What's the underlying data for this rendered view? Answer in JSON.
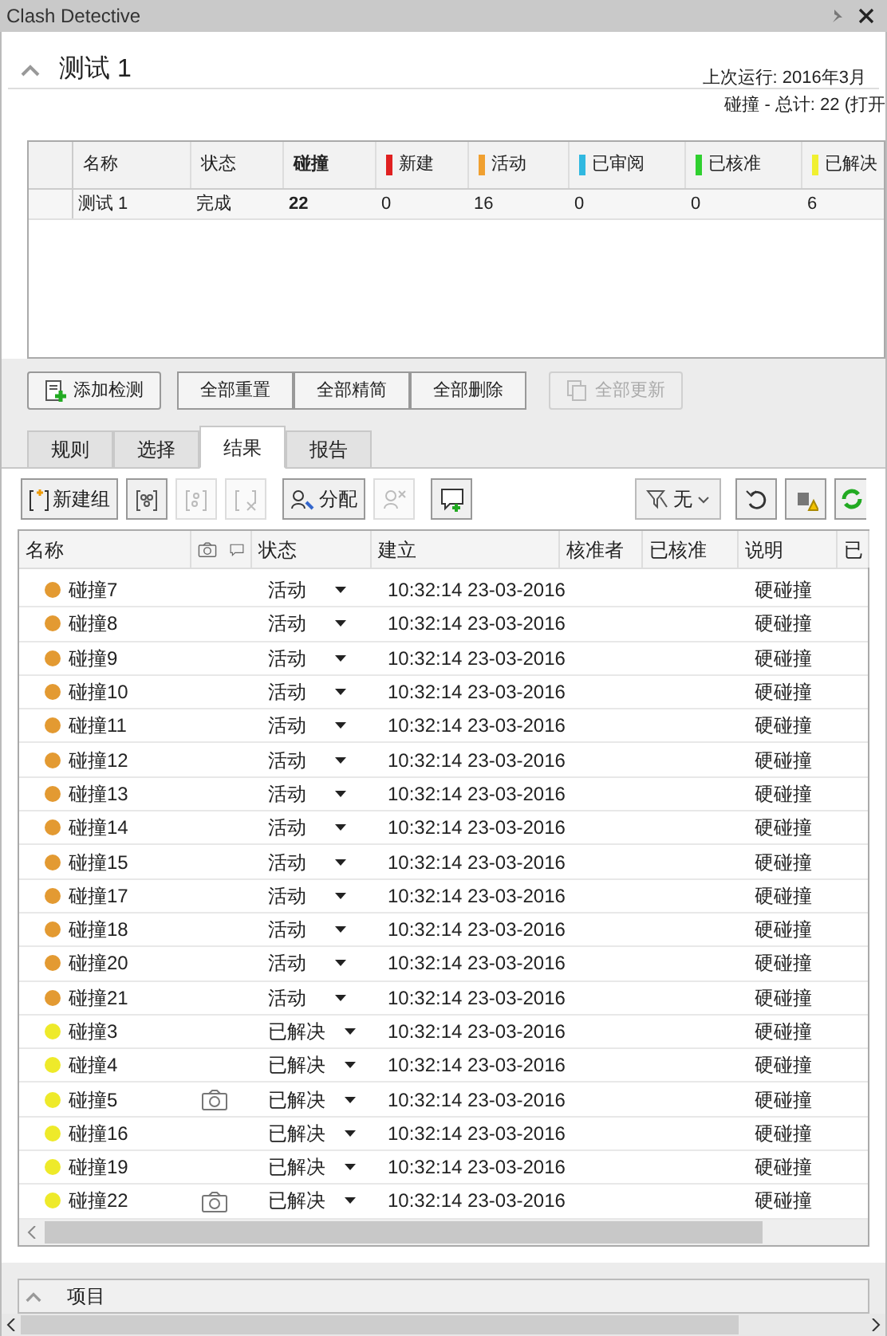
{
  "window": {
    "title": "Clash Detective"
  },
  "test": {
    "title": "测试 1",
    "expanded": true,
    "last_run": "上次运行: 2016年3月",
    "totals": "碰撞 - 总计: 22 (打开"
  },
  "summary": {
    "columns": [
      {
        "label": "名称"
      },
      {
        "label": "状态"
      },
      {
        "label": "碰撞",
        "bold": true
      },
      {
        "label": "新建",
        "color": "#e02020"
      },
      {
        "label": "活动",
        "color": "#f0a030"
      },
      {
        "label": "已审阅",
        "color": "#30b8e0"
      },
      {
        "label": "已核准",
        "color": "#30d030"
      },
      {
        "label": "已解决",
        "color": "#f0f030"
      }
    ],
    "rows": [
      {
        "cells": [
          "测试 1",
          "完成",
          "22",
          "0",
          "16",
          "0",
          "0",
          "6"
        ]
      }
    ]
  },
  "actions": [
    {
      "kind": "add",
      "label": "添加检测",
      "disabled": false
    },
    {
      "kind": "group",
      "label": "全部重置",
      "disabled": false
    },
    {
      "kind": "group",
      "label": "全部精简",
      "disabled": false
    },
    {
      "kind": "group",
      "label": "全部删除",
      "disabled": false
    },
    {
      "kind": "refresh",
      "label": "全部更新",
      "disabled": true
    }
  ],
  "tabs": [
    {
      "label": "规则",
      "selected": false
    },
    {
      "label": "选择",
      "selected": false
    },
    {
      "label": "结果",
      "selected": true
    },
    {
      "label": "报告",
      "selected": false
    }
  ],
  "toolbar": {
    "new_group": {
      "label": "新建组"
    },
    "assign": {
      "label": "分配"
    },
    "filter": {
      "label": "无"
    },
    "icons": [
      {
        "kind": "group-clash",
        "disabled": false
      },
      {
        "kind": "explode",
        "disabled": true
      },
      {
        "kind": "remove",
        "disabled": true
      },
      {
        "kind": "unassign",
        "disabled": true
      },
      {
        "kind": "comment",
        "disabled": false
      }
    ]
  },
  "results": {
    "columns": [
      "名称",
      "状态",
      "建立",
      "核准者",
      "已核准",
      "说明",
      "已"
    ],
    "rows": [
      {
        "name": "碰撞7",
        "color": "#e39a32",
        "viewpoint": false,
        "status": "活动",
        "created": "10:32:14 23-03-2016",
        "description": "硬碰撞"
      },
      {
        "name": "碰撞8",
        "color": "#e39a32",
        "viewpoint": false,
        "status": "活动",
        "created": "10:32:14 23-03-2016",
        "description": "硬碰撞"
      },
      {
        "name": "碰撞9",
        "color": "#e39a32",
        "viewpoint": false,
        "status": "活动",
        "created": "10:32:14 23-03-2016",
        "description": "硬碰撞"
      },
      {
        "name": "碰撞10",
        "color": "#e39a32",
        "viewpoint": false,
        "status": "活动",
        "created": "10:32:14 23-03-2016",
        "description": "硬碰撞"
      },
      {
        "name": "碰撞11",
        "color": "#e39a32",
        "viewpoint": false,
        "status": "活动",
        "created": "10:32:14 23-03-2016",
        "description": "硬碰撞"
      },
      {
        "name": "碰撞12",
        "color": "#e39a32",
        "viewpoint": false,
        "status": "活动",
        "created": "10:32:14 23-03-2016",
        "description": "硬碰撞"
      },
      {
        "name": "碰撞13",
        "color": "#e39a32",
        "viewpoint": false,
        "status": "活动",
        "created": "10:32:14 23-03-2016",
        "description": "硬碰撞"
      },
      {
        "name": "碰撞14",
        "color": "#e39a32",
        "viewpoint": false,
        "status": "活动",
        "created": "10:32:14 23-03-2016",
        "description": "硬碰撞"
      },
      {
        "name": "碰撞15",
        "color": "#e39a32",
        "viewpoint": false,
        "status": "活动",
        "created": "10:32:14 23-03-2016",
        "description": "硬碰撞"
      },
      {
        "name": "碰撞17",
        "color": "#e39a32",
        "viewpoint": false,
        "status": "活动",
        "created": "10:32:14 23-03-2016",
        "description": "硬碰撞"
      },
      {
        "name": "碰撞18",
        "color": "#e39a32",
        "viewpoint": false,
        "status": "活动",
        "created": "10:32:14 23-03-2016",
        "description": "硬碰撞"
      },
      {
        "name": "碰撞20",
        "color": "#e39a32",
        "viewpoint": false,
        "status": "活动",
        "created": "10:32:14 23-03-2016",
        "description": "硬碰撞"
      },
      {
        "name": "碰撞21",
        "color": "#e39a32",
        "viewpoint": false,
        "status": "活动",
        "created": "10:32:14 23-03-2016",
        "description": "硬碰撞"
      },
      {
        "name": "碰撞3",
        "color": "#eeea2a",
        "viewpoint": false,
        "status": "已解决",
        "created": "10:32:14 23-03-2016",
        "description": "硬碰撞"
      },
      {
        "name": "碰撞4",
        "color": "#eeea2a",
        "viewpoint": false,
        "status": "已解决",
        "created": "10:32:14 23-03-2016",
        "description": "硬碰撞"
      },
      {
        "name": "碰撞5",
        "color": "#eeea2a",
        "viewpoint": true,
        "status": "已解决",
        "created": "10:32:14 23-03-2016",
        "description": "硬碰撞"
      },
      {
        "name": "碰撞16",
        "color": "#eeea2a",
        "viewpoint": false,
        "status": "已解决",
        "created": "10:32:14 23-03-2016",
        "description": "硬碰撞"
      },
      {
        "name": "碰撞19",
        "color": "#eeea2a",
        "viewpoint": false,
        "status": "已解决",
        "created": "10:32:14 23-03-2016",
        "description": "硬碰撞"
      },
      {
        "name": "碰撞22",
        "color": "#eeea2a",
        "viewpoint": true,
        "status": "已解决",
        "created": "10:32:14 23-03-2016",
        "description": "硬碰撞"
      }
    ]
  },
  "items_panel": {
    "title": "项目"
  }
}
